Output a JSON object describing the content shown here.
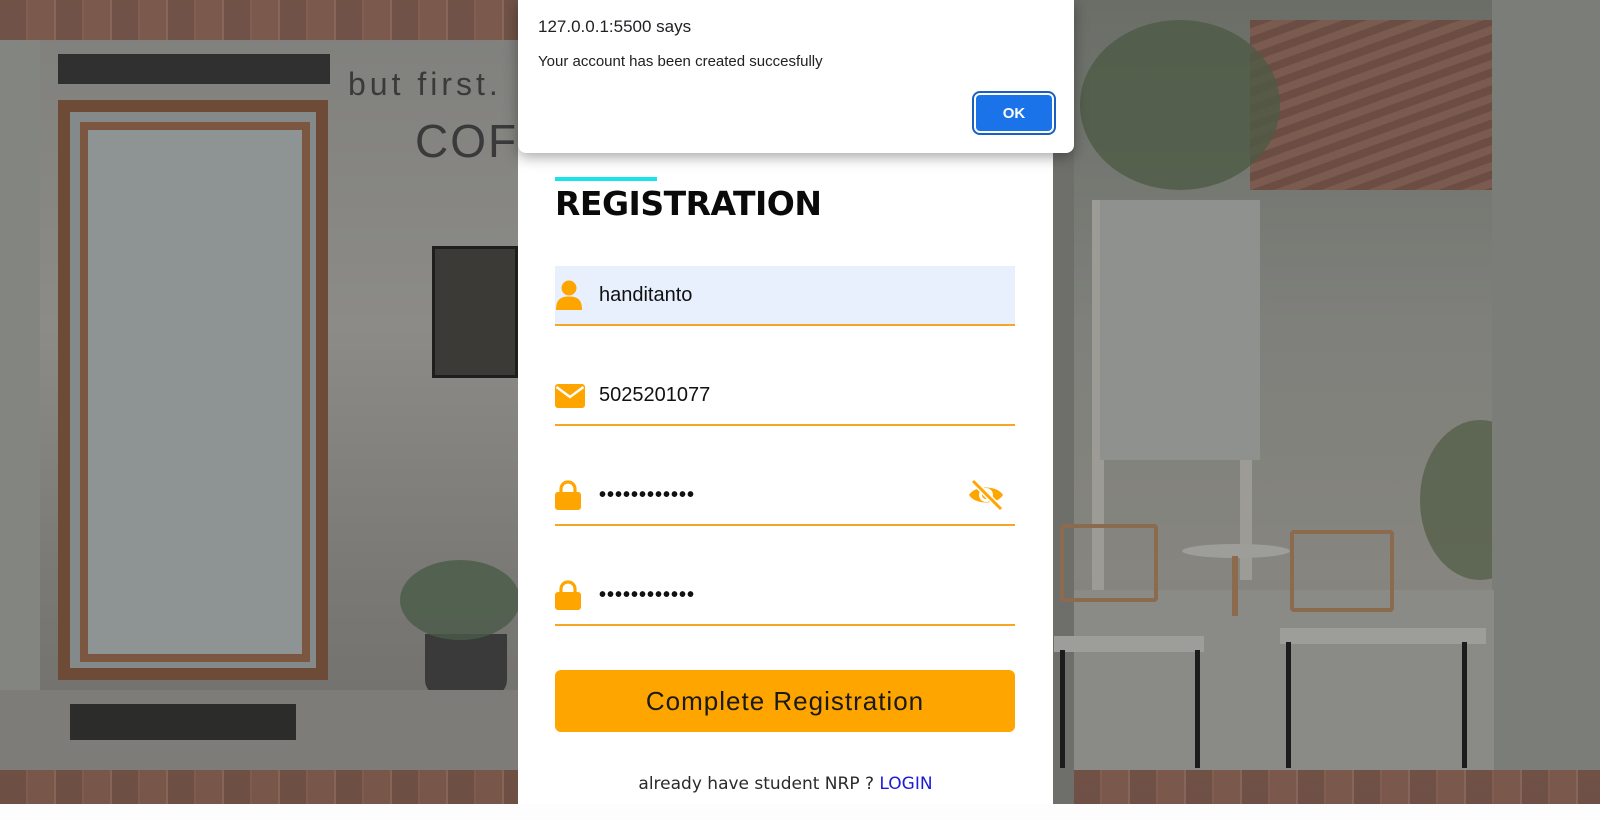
{
  "dialog": {
    "origin": "127.0.0.1:5500 says",
    "message": "Your account has been created succesfully",
    "ok_label": "OK"
  },
  "background": {
    "sign_line1": "but first.",
    "sign_line2": "COF"
  },
  "form": {
    "title": "REGISTRATION",
    "fields": [
      {
        "icon": "user-icon",
        "value": "handitanto",
        "type": "text"
      },
      {
        "icon": "envelope-icon",
        "value": "5025201077",
        "type": "text"
      },
      {
        "icon": "lock-icon",
        "value": "••••••••••••",
        "type": "password",
        "toggle_icon": "eye-slash-icon"
      },
      {
        "icon": "lock-icon",
        "value": "••••••••••••",
        "type": "password"
      }
    ],
    "submit_label": "Complete Registration",
    "footer_text": "already have student NRP ? ",
    "login_link": "LOGIN"
  },
  "colors": {
    "accent": "#ffa500",
    "title_bar": "#19e2ea",
    "link": "#1a1ad8",
    "dialog_button": "#1a73e8"
  }
}
